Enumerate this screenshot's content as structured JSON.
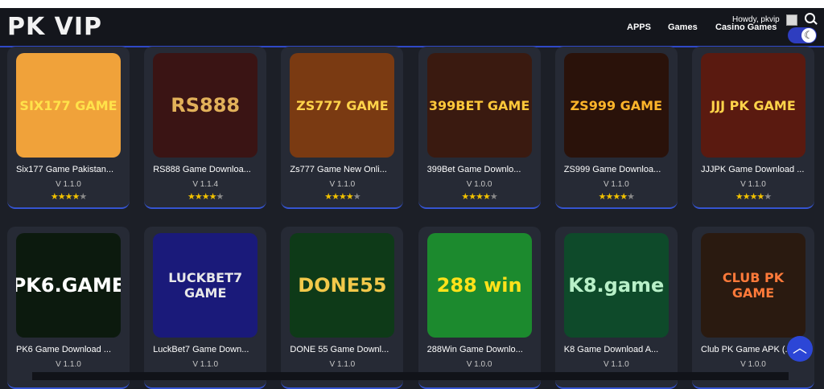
{
  "header": {
    "logo": "PK VIP",
    "nav": [
      "APPS",
      "Games",
      "Casino Games"
    ],
    "greeting": "Howdy, pkvip"
  },
  "accent": "#2f49c8",
  "cards": [
    {
      "thumb_text": "SIX177 GAME",
      "title": "Six177 Game Pakistan...",
      "version": "V 1.1.0",
      "rating": 4.5,
      "thumb_bg": "#f0a23a",
      "thumb_color": "#ffe24a"
    },
    {
      "thumb_text": "RS888",
      "title": "RS888 Game Downloa...",
      "version": "V 1.1.4",
      "rating": 4.5,
      "thumb_bg": "#3a1414",
      "thumb_color": "#e2b15a"
    },
    {
      "thumb_text": "ZS777 GAME",
      "title": "Zs777 Game New Onli...",
      "version": "V 1.1.0",
      "rating": 4.5,
      "thumb_bg": "#7a3a12",
      "thumb_color": "#ffd34a"
    },
    {
      "thumb_text": "399BET GAME",
      "title": "399Bet Game Downlo...",
      "version": "V 1.0.0",
      "rating": 4.5,
      "thumb_bg": "#3a1a10",
      "thumb_color": "#ffc83a"
    },
    {
      "thumb_text": "ZS999 GAME",
      "title": "ZS999 Game Downloa...",
      "version": "V 1.1.0",
      "rating": 4.5,
      "thumb_bg": "#2a120a",
      "thumb_color": "#ffb52a"
    },
    {
      "thumb_text": "JJJ PK GAME",
      "title": "JJJPK Game Download ...",
      "version": "V 1.1.0",
      "rating": 4.5,
      "thumb_bg": "#5a1a10",
      "thumb_color": "#ffd44a"
    },
    {
      "thumb_text": "PK6.GAME",
      "title": "PK6 Game Download ...",
      "version": "V 1.1.0",
      "rating": 4.5,
      "thumb_bg": "#0c1a0e",
      "thumb_color": "#ffffff"
    },
    {
      "thumb_text": "LUCKBET7 GAME",
      "title": "LuckBet7 Game Down...",
      "version": "V 1.1.0",
      "rating": 4.5,
      "thumb_bg": "#1a1a7a",
      "thumb_color": "#e8e8e8"
    },
    {
      "thumb_text": "DONE55",
      "title": "DONE 55 Game Downl...",
      "version": "V 1.1.0",
      "rating": 4.5,
      "thumb_bg": "#0e3a18",
      "thumb_color": "#f2c84a"
    },
    {
      "thumb_text": "288 win",
      "title": "288Win Game Downlo...",
      "version": "V 1.0.0",
      "rating": 4.5,
      "thumb_bg": "#1c8a2e",
      "thumb_color": "#ffe21a"
    },
    {
      "thumb_text": "K8.game",
      "title": "K8 Game Download A...",
      "version": "V 1.1.0",
      "rating": 4.5,
      "thumb_bg": "#0e4a2a",
      "thumb_color": "#b8f0c8"
    },
    {
      "thumb_text": "CLUB PK GAME",
      "title": "Club PK Game APK (...",
      "version": "V 1.0.0",
      "rating": 4.5,
      "thumb_bg": "#2a1a10",
      "thumb_color": "#ff7a3a"
    }
  ]
}
